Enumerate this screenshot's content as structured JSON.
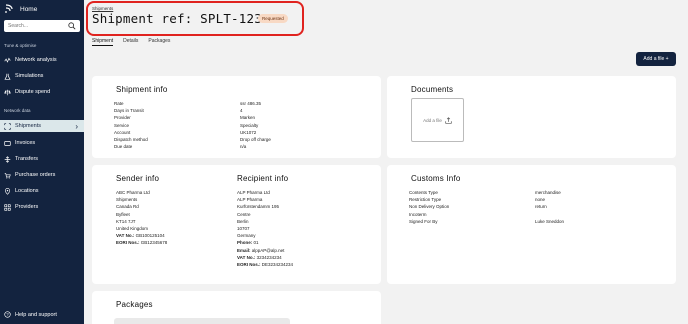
{
  "sidebar": {
    "home": "Home",
    "search_placeholder": "Search...",
    "section_tune": "Tune & optimise",
    "section_network": "Network data",
    "items": [
      {
        "label": "Network analysis"
      },
      {
        "label": "Simulations"
      },
      {
        "label": "Dispute spend"
      },
      {
        "label": "Shipments"
      },
      {
        "label": "Invoices"
      },
      {
        "label": "Transfers"
      },
      {
        "label": "Purchase orders"
      },
      {
        "label": "Locations"
      },
      {
        "label": "Providers"
      }
    ],
    "help": "Help and support"
  },
  "header": {
    "breadcrumb": "Shipments",
    "title": "Shipment ref: SPLT-123456",
    "status": "Requested",
    "highlight_color": "#e0231f"
  },
  "tabs": [
    "Shipment",
    "Details",
    "Packages"
  ],
  "add_file_button": "Add a file +",
  "shipment_info": {
    "heading": "Shipment info",
    "labels": [
      "Rate",
      "Days in Transit",
      "Provider",
      "Service",
      "Account",
      "Dispatch method",
      "Due date"
    ],
    "values": [
      "ssr 486.35",
      "4",
      "Marken",
      "Specialty",
      "UK1072",
      "Drop off charge",
      "n/a"
    ]
  },
  "documents": {
    "heading": "Documents",
    "add_file": "Add a file"
  },
  "sender_info": {
    "heading": "Sender info",
    "lines": [
      "ABC Pharma Ltd",
      "Shipments",
      "Canada Rd",
      "Byfleet",
      "KT14 7JT",
      "United Kingdom"
    ],
    "vat_label": "VAT No.:",
    "vat": "GB100125104",
    "eori_label": "EORI Nos.:",
    "eori": "GB12345678"
  },
  "recipient_info": {
    "heading": "Recipient info",
    "lines": [
      "ALP Pharma Ltd",
      "ALP Pharma",
      "Kurfürstendamm 195",
      "Centre",
      "Berlin",
      "10707",
      "Germany"
    ],
    "phone_label": "Phone:",
    "phone": "01",
    "email_label": "Email:",
    "email": "alppAP@alp.net",
    "vat_label": "VAT No.:",
    "vat": "3234234234",
    "eori_label": "EORI Nos.:",
    "eori": "DE3234234234"
  },
  "customs_info": {
    "heading": "Customs Info",
    "labels": [
      "Contents Type",
      "Restriction Type",
      "Non Delivery Option",
      "Incoterm",
      "Signed For By"
    ],
    "values": [
      "merchandise",
      "none",
      "return",
      "",
      "Luke Sneddon"
    ]
  },
  "packages": {
    "heading": "Packages"
  }
}
